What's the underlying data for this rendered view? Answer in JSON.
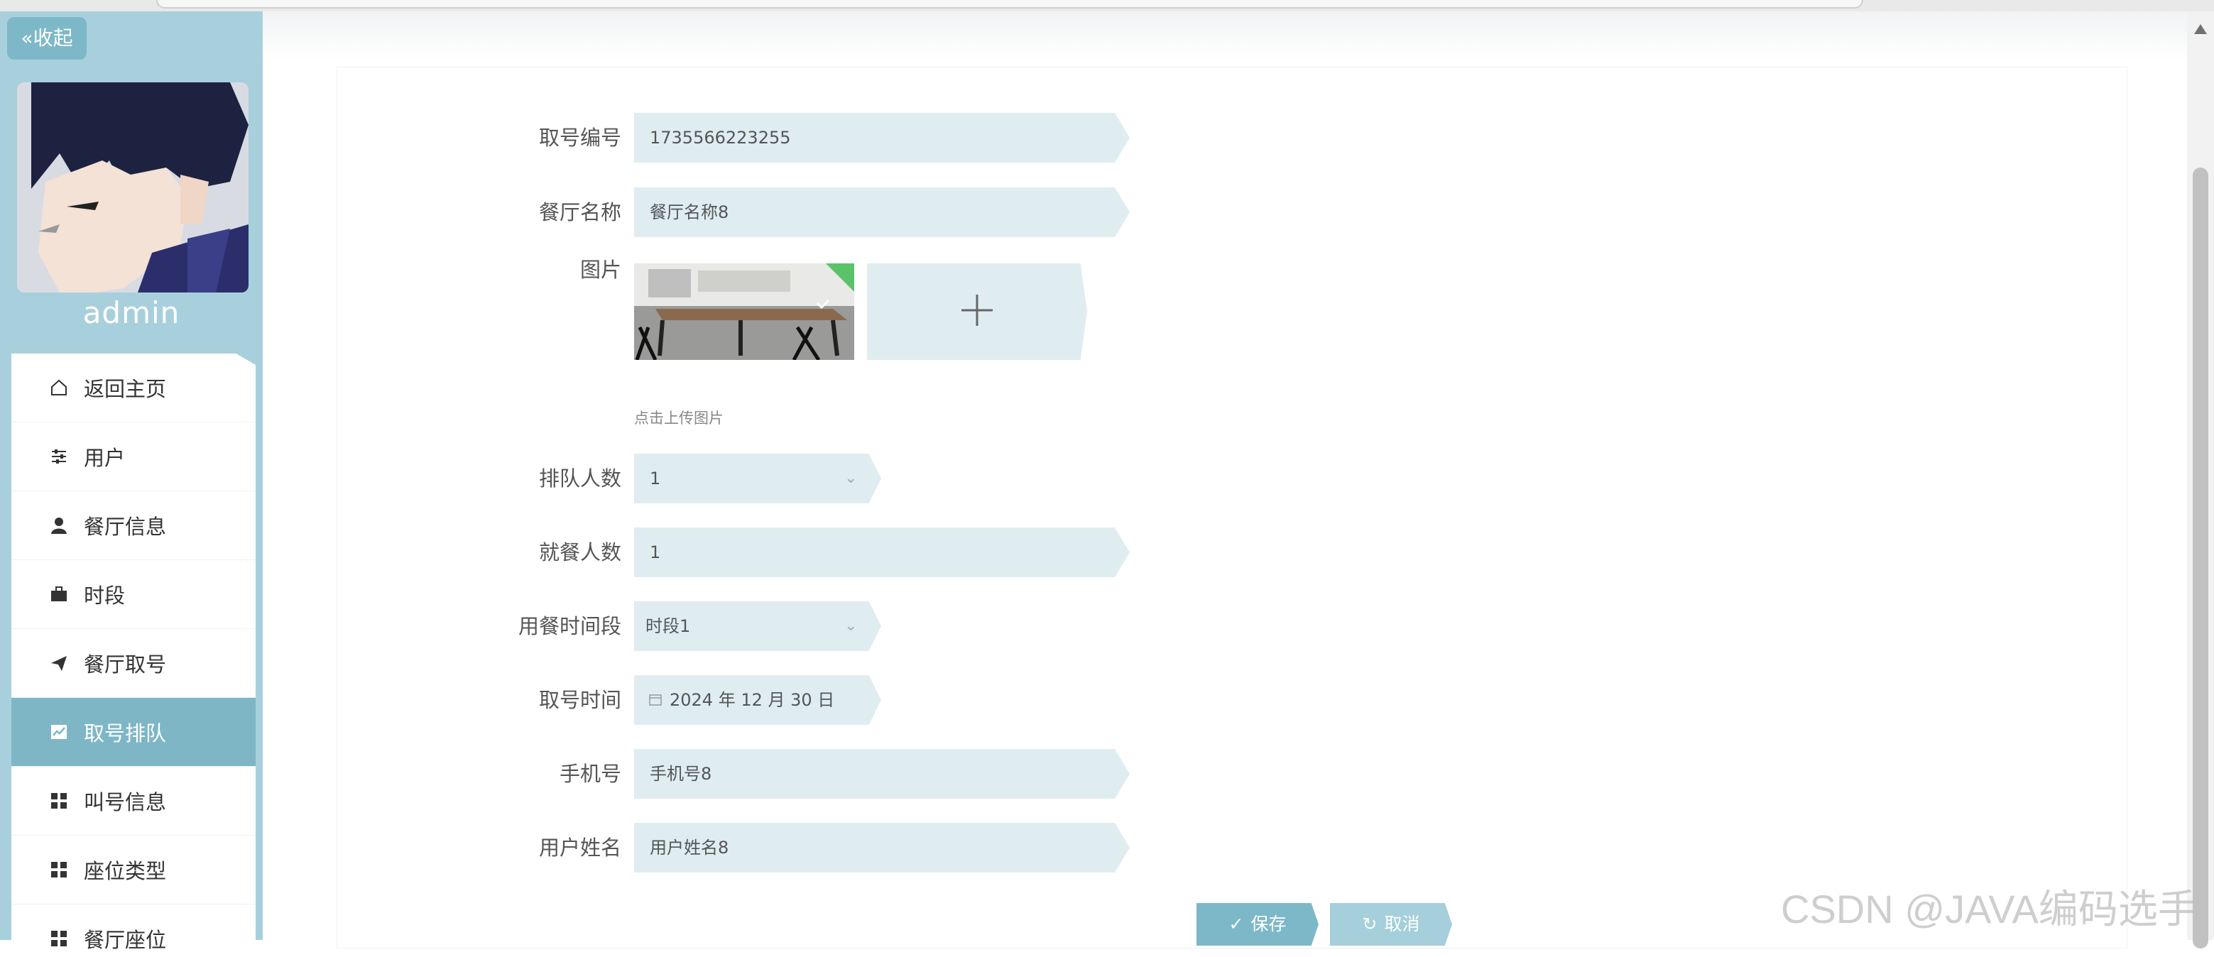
{
  "sidebar": {
    "collapse_label": "收起",
    "username": "admin",
    "items": [
      {
        "label": "返回主页",
        "icon": "home-icon"
      },
      {
        "label": "用户",
        "icon": "sliders-icon"
      },
      {
        "label": "餐厅信息",
        "icon": "user-icon"
      },
      {
        "label": "时段",
        "icon": "briefcase-icon"
      },
      {
        "label": "餐厅取号",
        "icon": "send-icon"
      },
      {
        "label": "取号排队",
        "icon": "chart-icon",
        "active": true
      },
      {
        "label": "叫号信息",
        "icon": "grid-icon"
      },
      {
        "label": "座位类型",
        "icon": "grid-icon"
      },
      {
        "label": "餐厅座位",
        "icon": "grid-icon"
      }
    ]
  },
  "form": {
    "ticket_no": {
      "label": "取号编号",
      "value": "1735566223255"
    },
    "restaurant": {
      "label": "餐厅名称",
      "value": "餐厅名称8"
    },
    "image": {
      "label": "图片",
      "hint": "点击上传图片"
    },
    "queue_count": {
      "label": "排队人数",
      "value": "1"
    },
    "diners": {
      "label": "就餐人数",
      "value": "1"
    },
    "time_slot": {
      "label": "用餐时间段",
      "value": "时段1"
    },
    "ticket_time": {
      "label": "取号时间",
      "value": "2024 年 12 月 30 日"
    },
    "phone": {
      "label": "手机号",
      "value": "手机号8"
    },
    "user_name": {
      "label": "用户姓名",
      "value": "用户姓名8"
    }
  },
  "actions": {
    "save_label": "保存",
    "cancel_label": "取消"
  },
  "watermark": "CSDN @JAVA编码选手",
  "colors": {
    "sidebar": "#a8d0dc",
    "accent": "#7db8c8",
    "field": "#dfedf1",
    "active_item": "#7eb6c6"
  }
}
